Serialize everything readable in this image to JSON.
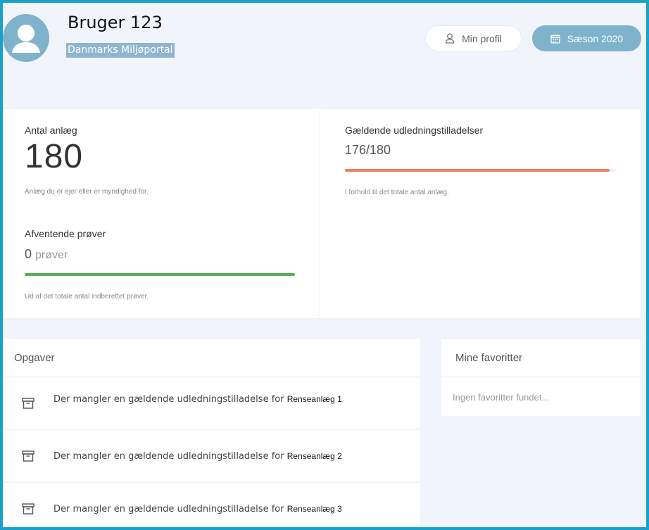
{
  "user": {
    "name": "Bruger 123",
    "organization": "Danmarks Miljøportal"
  },
  "header_buttons": {
    "profile_label": "Min profil",
    "season_label": "Sæson 2020"
  },
  "stats": {
    "plants": {
      "label": "Antal anlæg",
      "value": "180",
      "note": "Anlæg du er ejer eller er myndighed for."
    },
    "pending_samples": {
      "label": "Afventende prøver",
      "value": "0",
      "unit": "prøver",
      "progress": 1.0,
      "color": "#5cae5a",
      "note": "Ud af det totale antal indberettet prøver."
    },
    "permits": {
      "label": "Gældende udledningstilladelser",
      "value": "176/180",
      "progress": 0.978,
      "color": "#f0805f",
      "note": "I forhold til det totale antal anlæg."
    }
  },
  "tasks": {
    "title": "Opgaver",
    "items": [
      {
        "text": "Der mangler en gældende udledningstilladelse for",
        "plant": "Renseanlæg 1",
        "icon": "archive-box-icon"
      },
      {
        "text": "Der mangler en gældende udledningstilladelse for",
        "plant": "Renseanlæg 2",
        "icon": "archive-box-icon"
      },
      {
        "text": "Der mangler en gældende udledningstilladelse for",
        "plant": "Renseanlæg 3",
        "icon": "archive-box-icon"
      }
    ]
  },
  "favorites": {
    "title": "Mine favoritter",
    "empty_text": "Ingen favoritter fundet..."
  },
  "colors": {
    "accent": "#7fb3cc",
    "frame": "#17a3c9"
  }
}
